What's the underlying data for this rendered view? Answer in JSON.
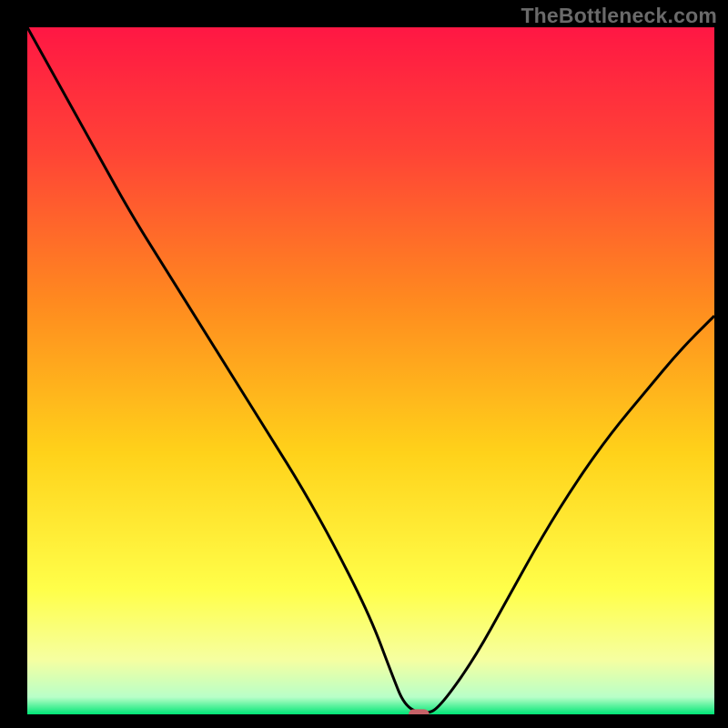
{
  "watermark": "TheBottleneck.com",
  "chart_data": {
    "type": "line",
    "title": "",
    "xlabel": "",
    "ylabel": "",
    "xlim": [
      0,
      100
    ],
    "ylim": [
      0,
      100
    ],
    "grid": false,
    "background": {
      "type": "vertical-gradient",
      "stops": [
        {
          "offset": 0.0,
          "color": "#ff1744"
        },
        {
          "offset": 0.18,
          "color": "#ff4336"
        },
        {
          "offset": 0.4,
          "color": "#ff8a1f"
        },
        {
          "offset": 0.62,
          "color": "#ffd21a"
        },
        {
          "offset": 0.82,
          "color": "#ffff4a"
        },
        {
          "offset": 0.92,
          "color": "#f6ffa0"
        },
        {
          "offset": 0.975,
          "color": "#b8ffc8"
        },
        {
          "offset": 1.0,
          "color": "#00e676"
        }
      ]
    },
    "series": [
      {
        "name": "bottleneck-curve",
        "color": "#000000",
        "x": [
          0,
          5,
          10,
          15,
          20,
          25,
          30,
          35,
          40,
          45,
          50,
          53,
          55,
          58,
          60,
          65,
          70,
          75,
          80,
          85,
          90,
          95,
          100
        ],
        "y": [
          100,
          91,
          82,
          73,
          65,
          57,
          49,
          41,
          33,
          24,
          14,
          6,
          1,
          0,
          1,
          8,
          17,
          26,
          34,
          41,
          47,
          53,
          58
        ]
      }
    ],
    "marker": {
      "name": "optimal-point",
      "x": 57,
      "y": 0,
      "color": "#c76268",
      "shape": "rounded-rect",
      "width_pct": 3.0,
      "height_pct": 1.5
    }
  }
}
